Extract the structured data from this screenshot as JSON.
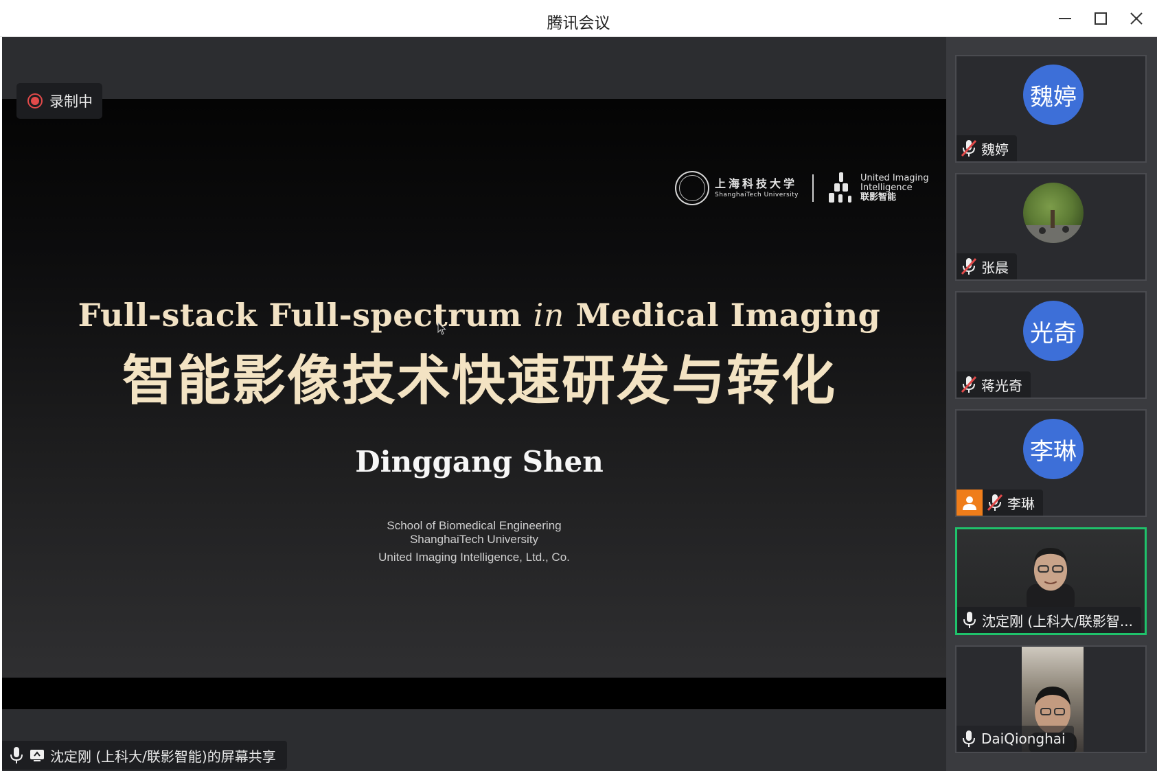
{
  "window": {
    "title": "腾讯会议"
  },
  "recording": {
    "label": "录制中"
  },
  "slide": {
    "university_cn": "上海科技大学",
    "university_en": "ShanghaiTech University",
    "company_line1": "United Imaging",
    "company_line2": "Intelligence",
    "company_cn": "联影智能",
    "title_en_part1": "Full-stack Full-spectrum ",
    "title_en_italic": "in",
    "title_en_part2": " Medical Imaging",
    "title_cn": "智能影像技术快速研发与转化",
    "presenter": "Dinggang Shen",
    "affiliation_line1": "School of Biomedical Engineering",
    "affiliation_line2": "ShanghaiTech University",
    "affiliation_line3": "United Imaging Intelligence, Ltd., Co."
  },
  "screen_share": {
    "label": "沈定刚 (上科大/联影智能)的屏幕共享"
  },
  "participants": [
    {
      "name": "魏婷",
      "avatar_text": "魏婷",
      "muted": true
    },
    {
      "name": "张晨",
      "avatar_text": "",
      "muted": true
    },
    {
      "name": "蒋光奇",
      "avatar_text": "光奇",
      "muted": true
    },
    {
      "name": "李琳",
      "avatar_text": "李琳",
      "muted": true,
      "host": true
    },
    {
      "name": "沈定刚 (上科大/联影智...",
      "avatar_text": "",
      "muted": false,
      "speaking": true
    },
    {
      "name": "DaiQionghai",
      "avatar_text": "",
      "muted": false
    }
  ],
  "colors": {
    "avatar_blue": "#3d6fd8",
    "speaking_green": "#1fc26b",
    "recording_red": "#e24a4a",
    "host_orange": "#ef7d1a",
    "title_gold": "#f2e2c4"
  }
}
